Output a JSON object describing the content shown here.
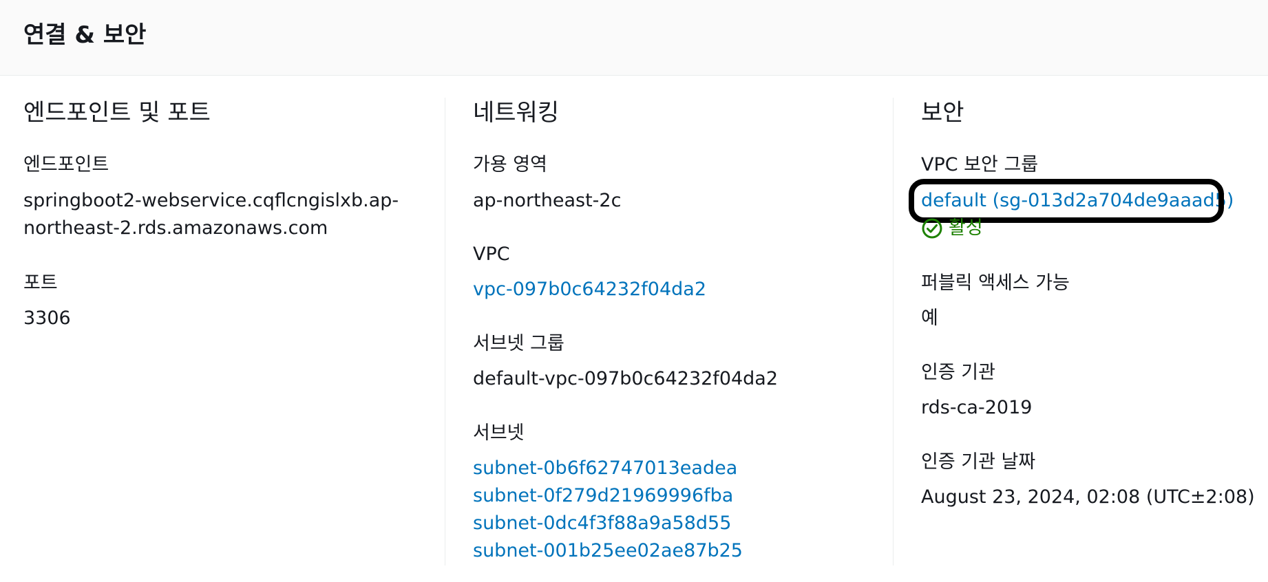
{
  "panel": {
    "title": "연결 & 보안"
  },
  "endpoint_section": {
    "title": "엔드포인트 및 포트",
    "endpoint_label": "엔드포인트",
    "endpoint_value_line1": "springboot2-webservice.cqflcngislxb.ap-",
    "endpoint_value_line2": "northeast-2.rds.amazonaws.com",
    "port_label": "포트",
    "port_value": "3306"
  },
  "networking_section": {
    "title": "네트워킹",
    "az_label": "가용 영역",
    "az_value": "ap-northeast-2c",
    "vpc_label": "VPC",
    "vpc_value": "vpc-097b0c64232f04da2",
    "subnet_group_label": "서브넷 그룹",
    "subnet_group_value": "default-vpc-097b0c64232f04da2",
    "subnets_label": "서브넷",
    "subnets": [
      "subnet-0b6f62747013eadea",
      "subnet-0f279d21969996fba",
      "subnet-0dc4f3f88a9a58d55",
      "subnet-001b25ee02ae87b25"
    ]
  },
  "security_section": {
    "title": "보안",
    "sg_label": "VPC 보안 그룹",
    "sg_value": "default (sg-013d2a704de9aaad5)",
    "sg_status": "활성",
    "public_label": "퍼블릭 액세스 가능",
    "public_value": "예",
    "ca_label": "인증 기관",
    "ca_value": "rds-ca-2019",
    "ca_date_label": "인증 기관 날짜",
    "ca_date_value": "August 23, 2024, 02:08 (UTC±2:08)"
  },
  "colors": {
    "link": "#0073bb",
    "status_success": "#1d8102",
    "header_bg": "#fafafa",
    "divider": "#eaeded",
    "text": "#16191f"
  },
  "icons": {
    "status": "check-circle-icon"
  }
}
